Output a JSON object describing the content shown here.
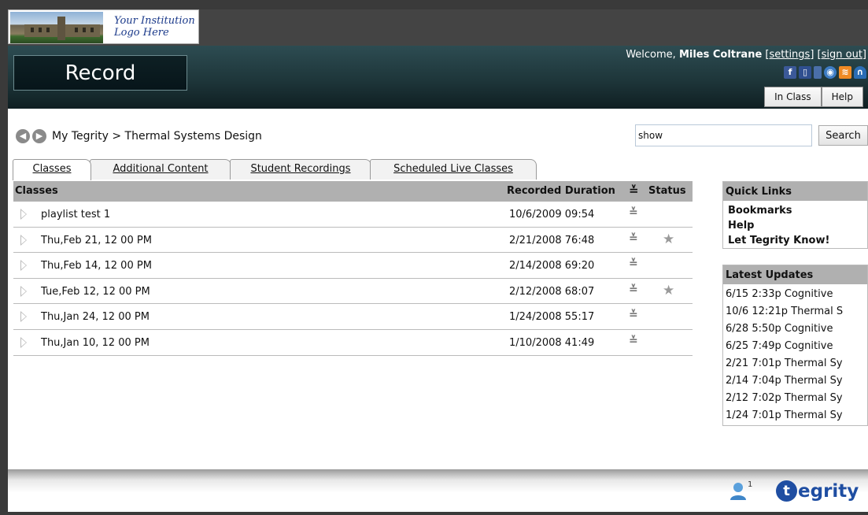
{
  "header": {
    "logo_text_line1": "Your Institution",
    "logo_text_line2": "Logo Here",
    "page_title": "Record",
    "welcome_prefix": "Welcome,",
    "user_name": "Miles Coltrane",
    "settings_link": "[settings]",
    "signout_link": "[sign out]",
    "social_icons": [
      "facebook-icon",
      "phone-icon",
      "mobile-icon",
      "globe-icon",
      "rss-icon",
      "headphones-icon"
    ],
    "in_class_label": "In Class",
    "help_label": "Help"
  },
  "breadcrumb": {
    "back": "back-icon",
    "forward": "forward-icon",
    "text": "My Tegrity > Thermal Systems Design"
  },
  "search": {
    "value": "show",
    "button_label": "Search"
  },
  "tabs": [
    {
      "label": "Classes",
      "active": true
    },
    {
      "label": "Additional Content",
      "active": false
    },
    {
      "label": "Student Recordings",
      "active": false
    },
    {
      "label": "Scheduled Live Classes",
      "active": false
    }
  ],
  "classes_table": {
    "headers": {
      "classes": "Classes",
      "recorded_duration": "Recorded Duration",
      "status": "Status"
    },
    "rows": [
      {
        "title": "playlist test 1",
        "recorded": "10/6/2009 09:54",
        "starred": false
      },
      {
        "title": "Thu,Feb 21, 12 00 PM",
        "recorded": "2/21/2008 76:48",
        "starred": true
      },
      {
        "title": "Thu,Feb 14, 12 00 PM",
        "recorded": "2/14/2008 69:20",
        "starred": false
      },
      {
        "title": "Tue,Feb 12, 12 00 PM",
        "recorded": "2/12/2008 68:07",
        "starred": true
      },
      {
        "title": "Thu,Jan 24, 12 00 PM",
        "recorded": "1/24/2008 55:17",
        "starred": false
      },
      {
        "title": "Thu,Jan 10, 12 00 PM",
        "recorded": "1/10/2008 41:49",
        "starred": false
      }
    ]
  },
  "quick_links": {
    "title": "Quick Links",
    "items": [
      "Bookmarks",
      "Help",
      "Let Tegrity Know!"
    ]
  },
  "latest_updates": {
    "title": "Latest Updates",
    "items": [
      "6/15 2:33p Cognitive",
      "10/6 12:21p Thermal S",
      "6/28 5:50p Cognitive",
      "6/25 7:49p Cognitive",
      "2/21 7:01p Thermal Sy",
      "2/14 7:04p Thermal Sy",
      "2/12 7:02p Thermal Sy",
      "1/24 7:01p Thermal Sy"
    ]
  },
  "footer": {
    "users_online": "1",
    "brand": "egrity"
  },
  "colors": {
    "brand_blue": "#1f4ea2",
    "header_teal": "#1e363a",
    "table_header_gray": "#b0b0b0"
  }
}
